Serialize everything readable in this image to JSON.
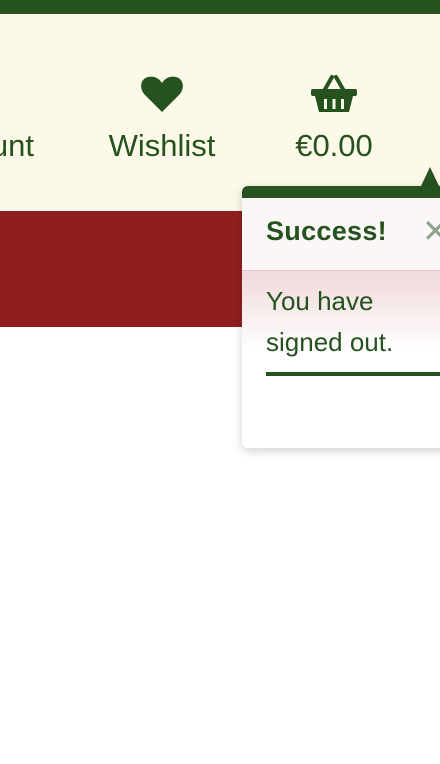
{
  "header": {
    "nav": [
      {
        "label": "unt",
        "icon": "user-icon"
      },
      {
        "label": "Wishlist",
        "icon": "heart-icon"
      },
      {
        "label": "€0.00",
        "icon": "basket-icon"
      }
    ]
  },
  "toast": {
    "title": "Success!",
    "close_symbol": "✕",
    "message": "You have signed out."
  },
  "colors": {
    "brand_green": "#25521f",
    "header_bg": "#fdf9e8",
    "red_band": "#8f1f1f",
    "close_gray": "#8fa28c"
  }
}
